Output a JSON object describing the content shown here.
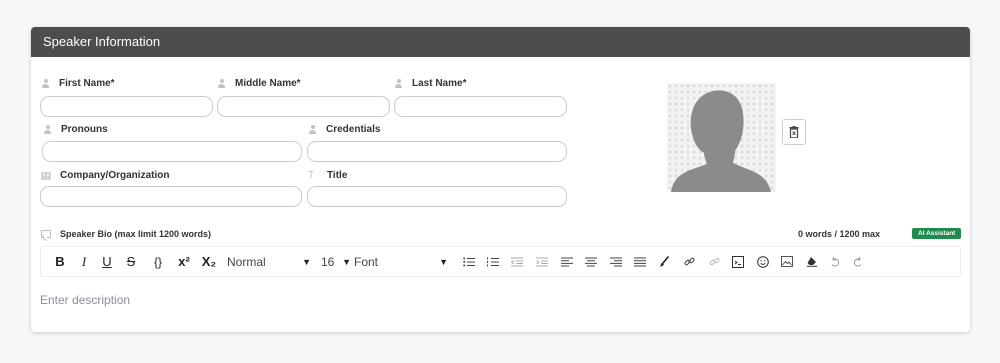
{
  "header": {
    "title": "Speaker Information"
  },
  "fields": {
    "first_name": {
      "label": "First Name*",
      "value": ""
    },
    "middle_name": {
      "label": "Middle Name*",
      "value": ""
    },
    "last_name": {
      "label": "Last Name*",
      "value": ""
    },
    "pronouns": {
      "label": "Pronouns",
      "value": ""
    },
    "credentials": {
      "label": "Credentials",
      "value": ""
    },
    "company": {
      "label": "Company/Organization",
      "value": ""
    },
    "title": {
      "label": "Title",
      "value": ""
    }
  },
  "bio": {
    "label": "Speaker Bio (max limit 1200 words)",
    "word_count": "0 words / 1200 max",
    "ai_label": "AI Assistant",
    "placeholder": "Enter description"
  },
  "toolbar": {
    "bold": "B",
    "italic": "I",
    "underline": "U",
    "strike": "S",
    "code": "{}",
    "superscript": "x²",
    "subscript": "X₂",
    "format": "Normal",
    "size": "16",
    "font": "Font"
  },
  "colors": {
    "header_bg": "#4d4d4d",
    "ai_button": "#1e8a4c",
    "input_border": "#c9ccd1"
  },
  "icons": {
    "name_fields": "person-icon",
    "company": "building-icon",
    "title": "text-t-icon",
    "bio": "chat-bubble-icon",
    "photo": "avatar-silhouette",
    "delete_photo": "trash-icon"
  }
}
